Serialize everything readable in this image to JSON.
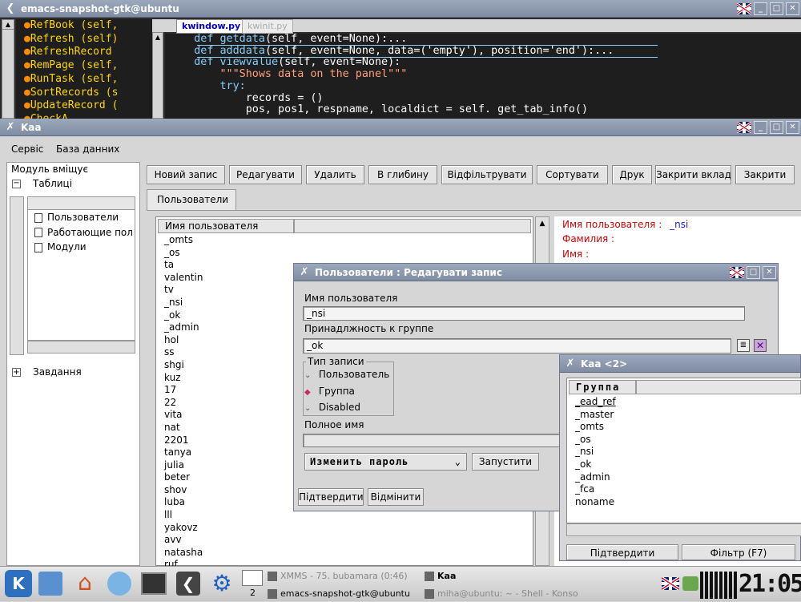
{
  "emacs": {
    "title": "emacs-snapshot-gtk@ubuntu",
    "outline": [
      "RefBook (self,",
      "Refresh (self)",
      "RefreshRecord",
      "RemPage (self,",
      "RunTask (self,",
      "SortRecords (s",
      "UpdateRecord (",
      "CheckA..."
    ],
    "tab_active": "kwindow.py",
    "tab_inactive": "kwinit.py",
    "code": [
      {
        "indent": "    ",
        "kw": "def ",
        "fn": "getdata",
        "rest": "(self, event=None):..."
      },
      {
        "indent": "    ",
        "kw": "def ",
        "fn": "adddata",
        "rest": "(self, event=None, data=('empty'), position='end'):..."
      },
      {
        "indent": "    ",
        "kw": "def ",
        "fn": "viewvalue",
        "rest": "(self, event=None):"
      },
      {
        "indent": "        ",
        "str": "\"\"\"Shows data on the panel\"\"\""
      },
      {
        "indent": "        ",
        "kw2": "try:"
      },
      {
        "indent": "            ",
        "plain": "records = ()"
      },
      {
        "indent": "            ",
        "plain": "pos, pos1, respname, localdict = self. get_tab_info()"
      }
    ]
  },
  "kaa": {
    "title": "Kaa",
    "menu": [
      "Сервіс",
      "База данних"
    ],
    "sidebar_title": "Модуль вміщує",
    "tree_tables": "Таблиці",
    "tree_items": [
      "Пользователи",
      "Работающие пол",
      "Модули"
    ],
    "tree_tasks": "Завдання",
    "toolbar": [
      "Новий запис",
      "Редагувати",
      "Удалить",
      "В глибину",
      "Відфільтрувати",
      "Сортувати",
      "Друк",
      "Закрити вкладк",
      "Закрити"
    ],
    "tab": "Пользователи",
    "col_header": "Имя пользователя",
    "users": [
      "_omts",
      "_os",
      "ta",
      "valentin",
      "tv",
      "_nsi",
      "_ok",
      "_admin",
      "hol",
      "ss",
      "shgi",
      "kuz",
      "17",
      "22",
      "vita",
      "nat",
      "2201",
      "tanya",
      "julia",
      "beter",
      "shov",
      "luba",
      "lll",
      "yakovz",
      "avv",
      "natasha",
      "ruf"
    ],
    "detail": {
      "user_label": "Имя пользователя :",
      "user_value": "_nsi",
      "surname_label": "Фамилия :",
      "name_label": "Имя :"
    }
  },
  "edit": {
    "title": "Пользователи : Редагувати запис",
    "user_label": "Имя пользователя",
    "user_value": "_nsi",
    "group_label": "Принадлжность к группе",
    "group_value": "_ok",
    "type_label": "Тип записи",
    "radio": [
      "Пользователь",
      "Группа",
      "Disabled"
    ],
    "selected": 1,
    "fullname_label": "Полное имя",
    "change_pw": "Изменить пароль",
    "run": "Запустити",
    "confirm": "Підтвердити",
    "cancel": "Відмінити"
  },
  "kaa2": {
    "title": "Kaa <2>",
    "header": "Группа",
    "groups": [
      "_ead_ref",
      "_master",
      "_omts",
      "_os",
      "_nsi",
      "_ok",
      "_admin",
      "_fca",
      "noname"
    ],
    "confirm": "Підтвердити",
    "filter": "Фільтр (F7)"
  },
  "taskbar": {
    "desk": "2",
    "tasks": [
      "XMMS - 75. bubamara (0:46)",
      "Kaa",
      "emacs-snapshot-gtk@ubuntu",
      "miha@ubuntu: ~ - Shell - Konso"
    ],
    "clock": "21:05"
  }
}
